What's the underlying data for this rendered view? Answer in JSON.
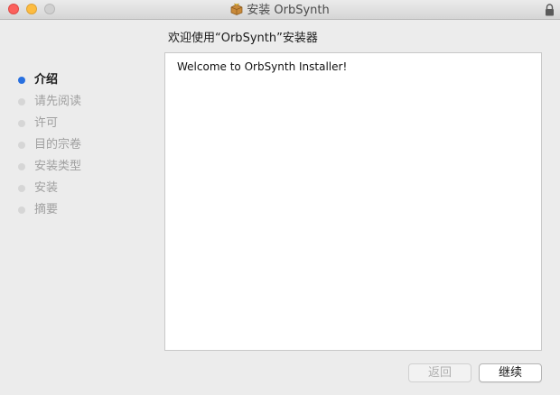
{
  "window": {
    "title": "安装 OrbSynth",
    "title_icon": "package-icon",
    "lock_icon": "lock-icon"
  },
  "heading": "欢迎使用“OrbSynth”安装器",
  "steps": [
    {
      "label": "介绍",
      "active": true
    },
    {
      "label": "请先阅读",
      "active": false
    },
    {
      "label": "许可",
      "active": false
    },
    {
      "label": "目的宗卷",
      "active": false
    },
    {
      "label": "安装类型",
      "active": false
    },
    {
      "label": "安装",
      "active": false
    },
    {
      "label": "摘要",
      "active": false
    }
  ],
  "content": {
    "text": "Welcome to OrbSynth Installer!"
  },
  "buttons": {
    "back_label": "返回",
    "back_enabled": false,
    "continue_label": "继续"
  },
  "colors": {
    "active_step": "#2870e0",
    "inactive_step": "#d6d6d6",
    "close": "#fc605c",
    "minimize": "#fdbc40"
  }
}
